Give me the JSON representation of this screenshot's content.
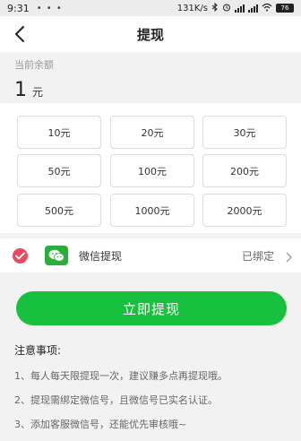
{
  "status_bar": {
    "time": "9:31",
    "dots": "• • •",
    "speed": "131K/s",
    "battery": "76"
  },
  "nav": {
    "title": "提现"
  },
  "balance": {
    "label": "当前余额",
    "amount": "1",
    "unit": "元"
  },
  "amounts": [
    "10元",
    "20元",
    "30元",
    "50元",
    "100元",
    "200元",
    "500元",
    "1000元",
    "2000元"
  ],
  "payment": {
    "method_label": "微信提现",
    "status": "已绑定"
  },
  "submit_label": "立即提现",
  "notes": {
    "heading": "注意事项:",
    "items": [
      "1、每人每天限提现一次，建议赚多点再提现哦。",
      "2、提现需绑定微信号，且微信号已实名认证。",
      "3、添加客服微信号，还能优先审核哦~"
    ]
  },
  "colors": {
    "accent_green": "#17c13d",
    "check_red": "#e84a5f",
    "wechat_green": "#2aae3a"
  }
}
